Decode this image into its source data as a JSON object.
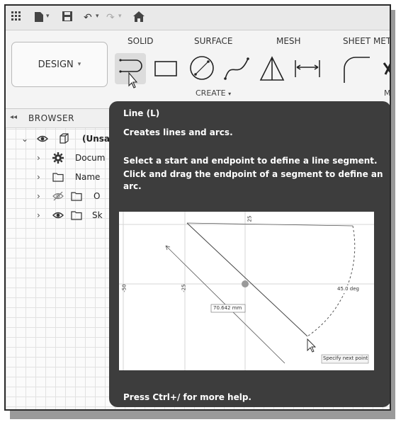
{
  "qat": {
    "icons": [
      "app-grid-icon",
      "file-icon",
      "save-icon",
      "undo-icon",
      "redo-icon",
      "home-icon"
    ]
  },
  "ribbon": {
    "workspace_label": "DESIGN",
    "workspace_caret": "▾",
    "tabs": [
      "SOLID",
      "SURFACE",
      "MESH",
      "SHEET MET"
    ],
    "group_label": "CREATE",
    "group_caret": "▾",
    "tools": [
      "line-tool",
      "rectangle-tool",
      "circle-tool",
      "spline-tool",
      "triangle-tool",
      "dimension-tool",
      "fillet-tool"
    ],
    "right_edge_label": "M"
  },
  "browser": {
    "title": "BROWSER",
    "items": [
      {
        "label": "(Unsa",
        "expanded": true
      },
      {
        "label": "Docum"
      },
      {
        "label": "Name"
      },
      {
        "label": "O"
      },
      {
        "label": "Sk"
      }
    ]
  },
  "tooltip": {
    "title": "Line (L)",
    "summary": "Creates lines and arcs.",
    "description_1": "Select a start and endpoint to define a line segment.",
    "description_2": "Click and drag the endpoint of a segment to define an arc.",
    "help": "Press Ctrl+/ for more help.",
    "preview": {
      "top_label": "25",
      "left_label_1": "-50",
      "left_label_2": "-25",
      "angle_label": "45.0 deg",
      "length_label": "70.642 mm",
      "prompt_label": "Specify next point"
    }
  },
  "colors": {
    "tooltip_bg": "#3d3d3d",
    "ribbon_bg": "#f4f4f4",
    "grid_line": "#e2e2e2"
  }
}
